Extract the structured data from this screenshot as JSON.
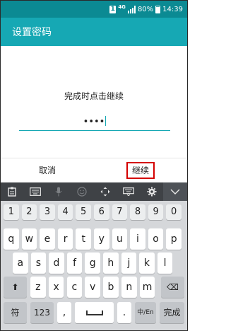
{
  "status_bar": {
    "sim_label": "1",
    "network": "4G",
    "battery": "80%",
    "time": "14:39"
  },
  "app_bar": {
    "title": "设置密码"
  },
  "dialog": {
    "message": "完成时点击继续",
    "pin_value": "••••",
    "cancel_label": "取消",
    "continue_label": "继续"
  },
  "keyboard": {
    "toolbar": [
      "clipboard-icon",
      "keyboard-icon",
      "mic-icon",
      "emoji-icon",
      "move-cursor-icon",
      "keyboard-layout-icon",
      "gear-icon",
      "chevron-down-icon"
    ],
    "numbers": [
      "1",
      "2",
      "3",
      "4",
      "5",
      "6",
      "7",
      "8",
      "9",
      "0"
    ],
    "row1": [
      "q",
      "w",
      "e",
      "r",
      "t",
      "y",
      "u",
      "i",
      "o",
      "p"
    ],
    "row1_hints": [
      "",
      "",
      "",
      "",
      "",
      "",
      "",
      "",
      "",
      ""
    ],
    "row2": [
      "a",
      "s",
      "d",
      "f",
      "g",
      "h",
      "j",
      "k",
      "l"
    ],
    "row3": [
      "z",
      "x",
      "c",
      "v",
      "b",
      "n",
      "m"
    ],
    "shift_glyph": "⬆",
    "backspace_glyph": "⌫",
    "bottom": {
      "symbols": "符",
      "digits": "123",
      "comma": ",",
      "space": "",
      "period": ".",
      "lang": "中/En",
      "done": "完成"
    }
  }
}
